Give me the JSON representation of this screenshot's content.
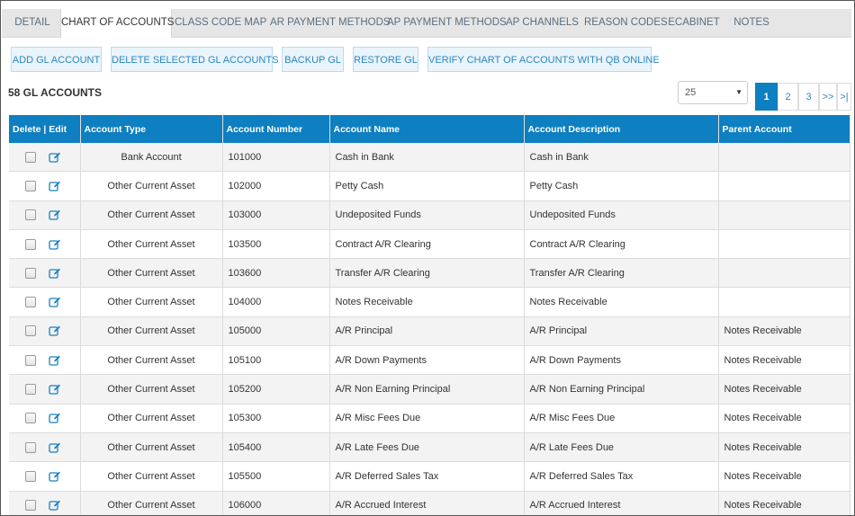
{
  "tabs": [
    {
      "label": "DETAIL"
    },
    {
      "label": "CHART OF ACCOUNTS"
    },
    {
      "label": "CLASS CODE MAP"
    },
    {
      "label": "AR PAYMENT METHODS"
    },
    {
      "label": "AP PAYMENT METHODS"
    },
    {
      "label": "AP CHANNELS"
    },
    {
      "label": "REASON CODES"
    },
    {
      "label": "ECABINET"
    },
    {
      "label": "NOTES"
    }
  ],
  "actions": {
    "add": "ADD GL ACCOUNT",
    "delete": "DELETE SELECTED GL ACCOUNTS",
    "backup": "BACKUP GL",
    "restore": "RESTORE GL",
    "verify": "VERIFY CHART OF ACCOUNTS WITH QB ONLINE"
  },
  "count_label": "58 GL ACCOUNTS",
  "page_size": "25",
  "pagination": [
    "1",
    "2",
    "3",
    ">>",
    ">|"
  ],
  "columns": {
    "delete_edit": "Delete | Edit",
    "type": "Account Type",
    "number": "Account Number",
    "name": "Account Name",
    "description": "Account Description",
    "parent": "Parent Account"
  },
  "rows": [
    {
      "type": "Bank Account",
      "number": "101000",
      "name": "Cash in Bank",
      "description": "Cash in Bank",
      "parent": ""
    },
    {
      "type": "Other Current Asset",
      "number": "102000",
      "name": "Petty Cash",
      "description": "Petty Cash",
      "parent": ""
    },
    {
      "type": "Other Current Asset",
      "number": "103000",
      "name": "Undeposited Funds",
      "description": "Undeposited Funds",
      "parent": ""
    },
    {
      "type": "Other Current Asset",
      "number": "103500",
      "name": "Contract A/R Clearing",
      "description": "Contract A/R Clearing",
      "parent": ""
    },
    {
      "type": "Other Current Asset",
      "number": "103600",
      "name": "Transfer A/R Clearing",
      "description": "Transfer A/R Clearing",
      "parent": ""
    },
    {
      "type": "Other Current Asset",
      "number": "104000",
      "name": "Notes Receivable",
      "description": "Notes Receivable",
      "parent": ""
    },
    {
      "type": "Other Current Asset",
      "number": "105000",
      "name": "A/R Principal",
      "description": "A/R Principal",
      "parent": "Notes Receivable"
    },
    {
      "type": "Other Current Asset",
      "number": "105100",
      "name": "A/R Down Payments",
      "description": "A/R Down Payments",
      "parent": "Notes Receivable"
    },
    {
      "type": "Other Current Asset",
      "number": "105200",
      "name": "A/R Non Earning Principal",
      "description": "A/R Non Earning Principal",
      "parent": "Notes Receivable"
    },
    {
      "type": "Other Current Asset",
      "number": "105300",
      "name": "A/R Misc Fees Due",
      "description": "A/R Misc Fees Due",
      "parent": "Notes Receivable"
    },
    {
      "type": "Other Current Asset",
      "number": "105400",
      "name": "A/R Late Fees Due",
      "description": "A/R Late Fees Due",
      "parent": "Notes Receivable"
    },
    {
      "type": "Other Current Asset",
      "number": "105500",
      "name": "A/R Deferred Sales Tax",
      "description": "A/R Deferred Sales Tax",
      "parent": "Notes Receivable"
    },
    {
      "type": "Other Current Asset",
      "number": "106000",
      "name": "A/R Accrued Interest",
      "description": "A/R Accrued Interest",
      "parent": "Notes Receivable"
    }
  ]
}
